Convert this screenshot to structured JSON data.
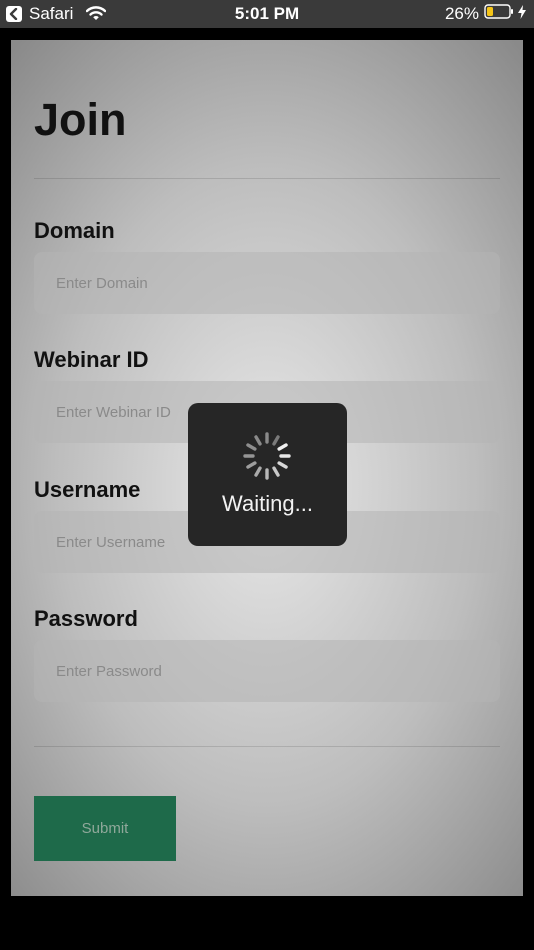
{
  "status_bar": {
    "back_app_label": "Safari",
    "time": "5:01 PM",
    "battery_percent": "26%",
    "icons": [
      "back-chevron-icon",
      "wifi-icon",
      "battery-icon",
      "charging-bolt-icon"
    ]
  },
  "form": {
    "title": "Join",
    "fields": [
      {
        "label": "Domain",
        "placeholder": "Enter Domain",
        "value": ""
      },
      {
        "label": "Webinar ID",
        "placeholder": "Enter Webinar ID",
        "value": ""
      },
      {
        "label": "Username",
        "placeholder": "Enter Username",
        "value": ""
      },
      {
        "label": "Password",
        "placeholder": "Enter Password",
        "value": ""
      }
    ],
    "submit_label": "Submit"
  },
  "loading": {
    "label": "Waiting...",
    "icon": "spinner-icon"
  },
  "colors": {
    "submit_button": "#1e6a4a",
    "battery_fill": "#f5c518",
    "hud_background": "#262626"
  }
}
